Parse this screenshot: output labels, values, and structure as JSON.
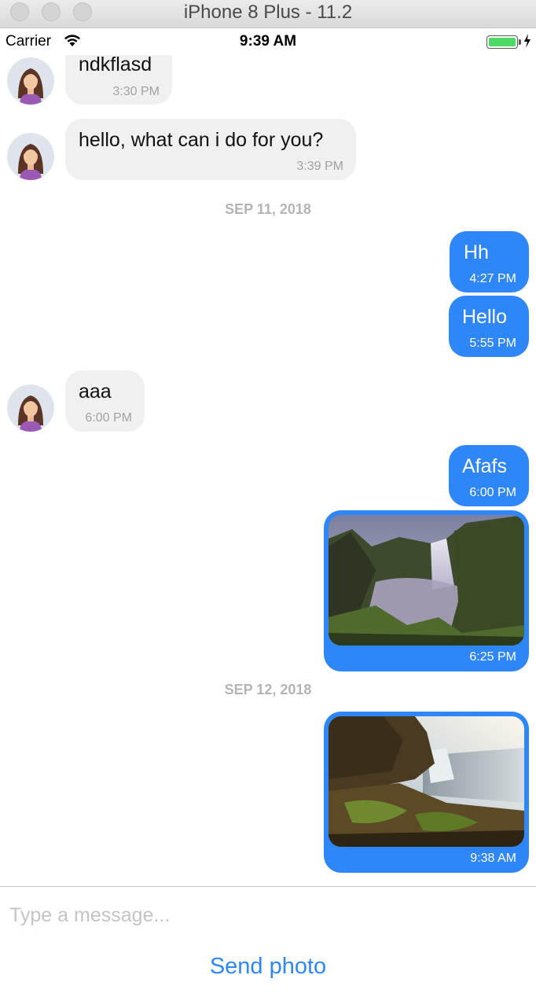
{
  "window": {
    "title": "iPhone 8 Plus - 11.2"
  },
  "status_bar": {
    "carrier": "Carrier",
    "time": "9:39 AM",
    "battery_color": "#4cd964"
  },
  "colors": {
    "outgoing_bubble": "#2f86f6",
    "incoming_bubble": "#f0f0f0",
    "date_separator": "#b4b4b4"
  },
  "chat": {
    "messages": [
      {
        "direction": "incoming",
        "text": "ndkflasd",
        "time": "3:30 PM"
      },
      {
        "direction": "incoming",
        "text": "hello, what can i do for you?",
        "time": "3:39 PM"
      },
      {
        "type": "date",
        "text": "SEP 11, 2018"
      },
      {
        "direction": "outgoing",
        "text": "Hh",
        "time": "4:27 PM"
      },
      {
        "direction": "outgoing",
        "text": "Hello",
        "time": "5:55 PM"
      },
      {
        "direction": "incoming",
        "text": "aaa",
        "time": "6:00 PM"
      },
      {
        "direction": "outgoing",
        "text": "Afafs",
        "time": "6:00 PM"
      },
      {
        "direction": "outgoing",
        "type": "photo",
        "image": "waterfall-photo",
        "time": "6:25 PM"
      },
      {
        "type": "date",
        "text": "SEP 12, 2018"
      },
      {
        "direction": "outgoing",
        "type": "photo",
        "image": "cliff-waterfall-photo",
        "time": "9:38 AM"
      }
    ]
  },
  "composer": {
    "placeholder": "Type a message...",
    "value": "",
    "send_photo_label": "Send photo"
  }
}
